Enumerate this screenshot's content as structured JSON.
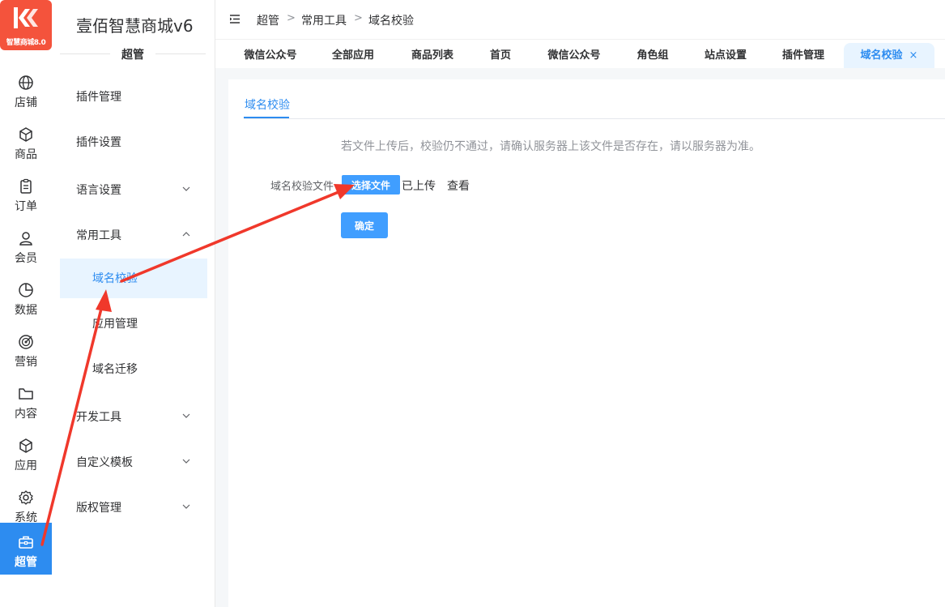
{
  "logo": {
    "text": "智慧商城8.0"
  },
  "rail": {
    "items": [
      {
        "label": "店铺",
        "icon": "globe-icon"
      },
      {
        "label": "商品",
        "icon": "cube-icon"
      },
      {
        "label": "订单",
        "icon": "clipboard-icon"
      },
      {
        "label": "会员",
        "icon": "user-icon"
      },
      {
        "label": "数据",
        "icon": "pie-chart-icon"
      },
      {
        "label": "营销",
        "icon": "target-icon"
      },
      {
        "label": "内容",
        "icon": "folder-icon"
      },
      {
        "label": "应用",
        "icon": "box-icon"
      },
      {
        "label": "系统",
        "icon": "gear-icon"
      },
      {
        "label": "超管",
        "icon": "toolbox-icon",
        "active": true
      }
    ]
  },
  "submenu": {
    "brand": "壹佰智慧商城v6",
    "section": "超管",
    "items": [
      {
        "label": "插件管理"
      },
      {
        "label": "插件设置"
      },
      {
        "label": "语言设置",
        "expandable": true
      },
      {
        "label": "常用工具",
        "expandable": true,
        "expanded": true
      },
      {
        "label": "域名校验",
        "sub": true,
        "selected": true
      },
      {
        "label": "应用管理",
        "sub": true
      },
      {
        "label": "域名迁移",
        "sub": true
      },
      {
        "label": "开发工具",
        "expandable": true
      },
      {
        "label": "自定义模板",
        "expandable": true
      },
      {
        "label": "版权管理",
        "expandable": true
      }
    ]
  },
  "header": {
    "breadcrumb": [
      "超管",
      "常用工具",
      "域名校验"
    ],
    "separator": ">"
  },
  "tabs": [
    {
      "label": "微信公众号"
    },
    {
      "label": "全部应用"
    },
    {
      "label": "商品列表"
    },
    {
      "label": "首页"
    },
    {
      "label": "微信公众号"
    },
    {
      "label": "角色组"
    },
    {
      "label": "站点设置"
    },
    {
      "label": "插件管理"
    },
    {
      "label": "域名校验",
      "active": true,
      "close": "×"
    }
  ],
  "panel": {
    "tab": "域名校验",
    "hint": "若文件上传后，校验仍不通过，请确认服务器上该文件是否存在，请以服务器为准。",
    "form_label": "域名校验文件",
    "choose_button": "选择文件",
    "uploaded_text": "已上传",
    "view_link": "查看",
    "confirm_button": "确定"
  },
  "colors": {
    "accent": "#2d8cf0",
    "button": "#409eff",
    "logo": "#f4533c",
    "annotation_arrow": "#f0382b"
  }
}
